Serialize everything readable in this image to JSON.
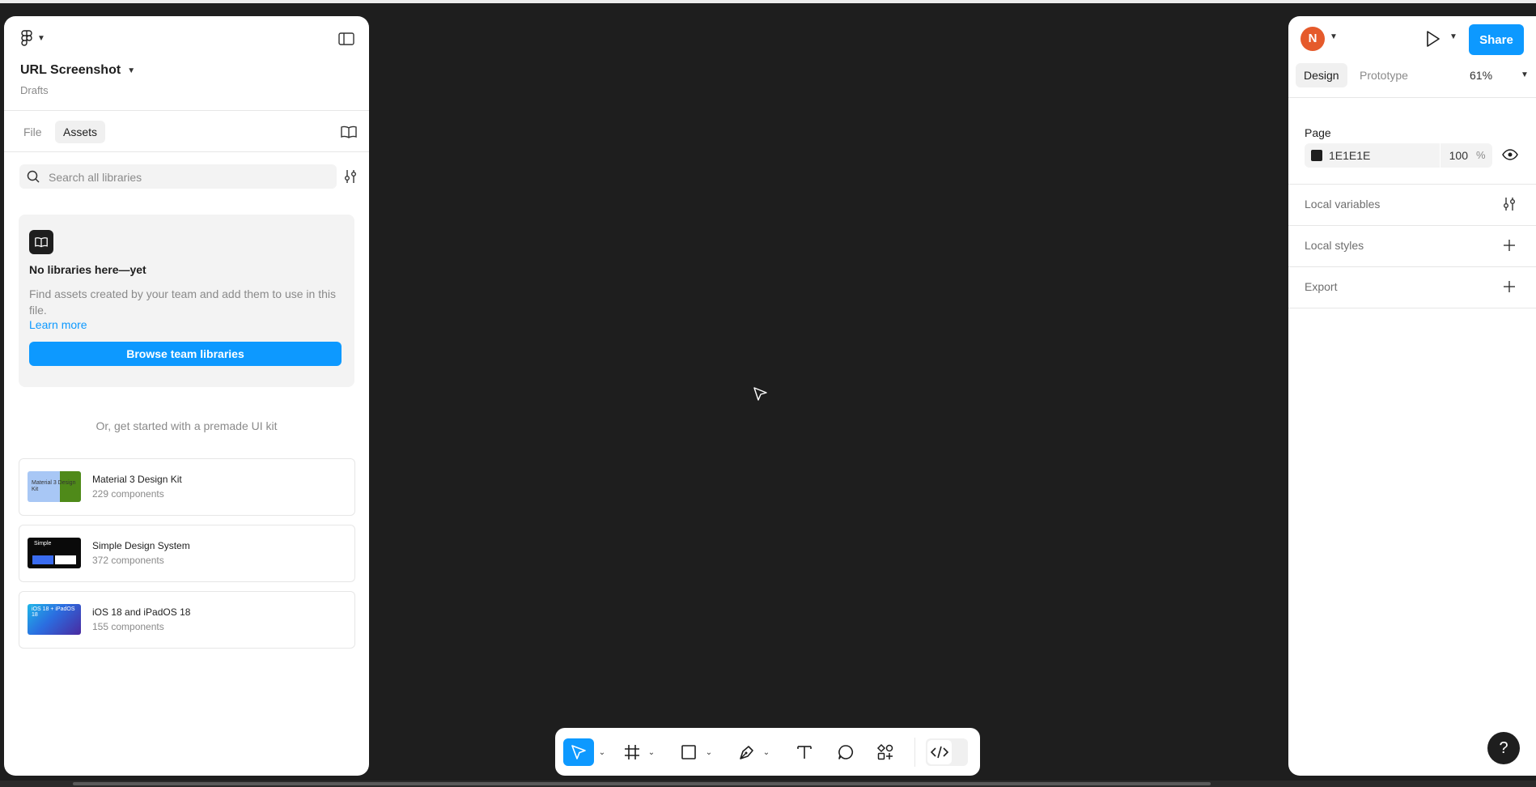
{
  "file": {
    "title": "URL Screenshot",
    "location": "Drafts"
  },
  "left_panel": {
    "tabs": [
      {
        "label": "File",
        "active": false
      },
      {
        "label": "Assets",
        "active": true
      }
    ],
    "search": {
      "placeholder": "Search all libraries",
      "value": ""
    },
    "empty_state": {
      "title": "No libraries here—yet",
      "description": "Find assets created by your team and add them to use in this file.",
      "link_label": "Learn more",
      "button_label": "Browse team libraries"
    },
    "kits_heading": "Or, get started with a premade UI kit",
    "kits": [
      {
        "name": "Material 3 Design Kit",
        "count": "229 components",
        "thumb_text": "Material 3 Design Kit"
      },
      {
        "name": "Simple Design System",
        "count": "372 components",
        "thumb_text": "Simple"
      },
      {
        "name": "iOS 18 and iPadOS 18",
        "count": "155 components",
        "thumb_text": "iOS 18 + iPadOS 18"
      }
    ]
  },
  "right_panel": {
    "avatar_initial": "N",
    "share_label": "Share",
    "tabs": [
      {
        "label": "Design",
        "active": true
      },
      {
        "label": "Prototype",
        "active": false
      }
    ],
    "zoom": "61%",
    "page_section": {
      "title": "Page",
      "fill_hex": "1E1E1E",
      "opacity": "100",
      "opacity_unit": "%"
    },
    "sections": [
      {
        "label": "Local variables",
        "action_icon": "adjust-icon"
      },
      {
        "label": "Local styles",
        "action_icon": "plus-icon"
      },
      {
        "label": "Export",
        "action_icon": "plus-icon"
      }
    ]
  },
  "toolbar": {
    "tools": [
      "move",
      "frame",
      "rectangle",
      "pen",
      "text",
      "comment",
      "actions",
      "dev-mode"
    ]
  },
  "help_label": "?",
  "colors": {
    "canvas": "#1E1E1E",
    "accent": "#0D99FF",
    "avatar": "#E55A2B"
  }
}
